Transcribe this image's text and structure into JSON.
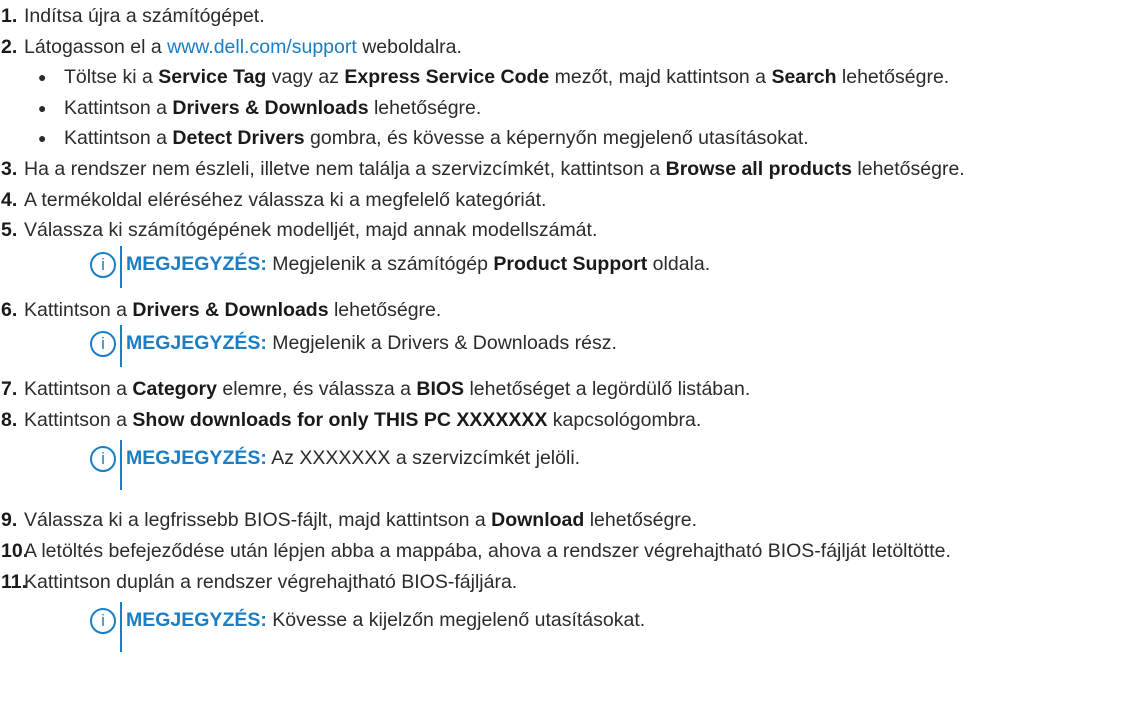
{
  "steps": [
    {
      "num": "1.",
      "text": "Indítsa újra a számítógépet."
    },
    {
      "num": "2.",
      "pre": "Látogasson el a ",
      "link": "www.dell.com/support",
      "post": " weboldalra."
    },
    {
      "num": "3.",
      "pre": "Ha a rendszer nem észleli, illetve nem találja a szervizcímkét, kattintson a ",
      "bold": "Browse all products",
      "post": " lehetőségre."
    },
    {
      "num": "4.",
      "text": "A termékoldal eléréséhez válassza ki a megfelelő kategóriát."
    },
    {
      "num": "5.",
      "text": "Válassza ki számítógépének modelljét, majd annak modellszámát."
    },
    {
      "num": "6.",
      "pre": "Kattintson a ",
      "bold": "Drivers & Downloads",
      "post": " lehetőségre."
    },
    {
      "num": "7.",
      "pre": "Kattintson a ",
      "bold": "Category",
      "mid": " elemre, és válassza a ",
      "bold2": "BIOS",
      "post": " lehetőséget a legördülő listában."
    },
    {
      "num": "8.",
      "pre": "Kattintson a ",
      "bold": "Show downloads for only THIS PC XXXXXXX",
      "post": " kapcsológombra."
    },
    {
      "num": "9.",
      "pre": "Válassza ki a legfrissebb BIOS-fájlt, majd kattintson a ",
      "bold": "Download",
      "post": " lehetőségre."
    },
    {
      "num": "10.",
      "text": "A letöltés befejeződése után lépjen abba a mappába, ahova a rendszer végrehajtható BIOS-fájlját letöltötte."
    },
    {
      "num": "11.",
      "text": "Kattintson duplán a rendszer végrehajtható BIOS-fájljára."
    }
  ],
  "bullets": [
    {
      "mark": "●",
      "pre": "Töltse ki a ",
      "b1": "Service Tag",
      "mid1": " vagy az ",
      "b2": "Express Service Code",
      "mid2": " mezőt, majd kattintson a ",
      "b3": "Search",
      "post": " lehetőségre."
    },
    {
      "mark": "●",
      "pre": "Kattintson a ",
      "bold": "Drivers & Downloads",
      "post": " lehetőségre."
    },
    {
      "mark": "●",
      "pre": "Kattintson a ",
      "bold": "Detect Drivers",
      "post": " gombra, és kövesse a képernyőn megjelenő utasításokat."
    }
  ],
  "notes": [
    {
      "icon": "i",
      "label": "MEGJEGYZÉS:",
      "pre": " Megjelenik a számítógép ",
      "bold": "Product Support",
      "post": " oldala."
    },
    {
      "icon": "i",
      "label": "MEGJEGYZÉS:",
      "text": " Megjelenik a Drivers & Downloads rész."
    },
    {
      "icon": "i",
      "label": "MEGJEGYZÉS:",
      "text": " Az XXXXXXX a szervizcímkét jelöli."
    },
    {
      "icon": "i",
      "label": "MEGJEGYZÉS:",
      "text": " Kövesse a kijelzőn megjelenő utasításokat."
    }
  ],
  "colors": {
    "accent": "#1a7ec5",
    "text": "#2b2b2b"
  }
}
